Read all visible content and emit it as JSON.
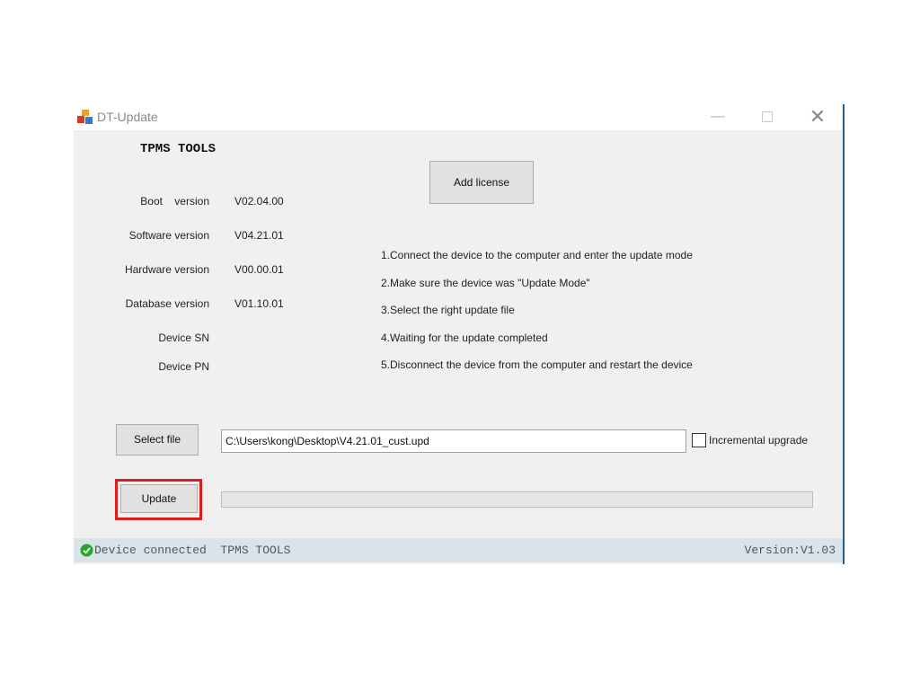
{
  "window": {
    "title": "DT-Update",
    "controls": {
      "minimize": "—",
      "close": "✕"
    }
  },
  "heading": "TPMS TOOLS",
  "info": [
    {
      "label": "Boot    version",
      "value": "V02.04.00"
    },
    {
      "label": "Software version",
      "value": "V04.21.01"
    },
    {
      "label": "Hardware version",
      "value": "V00.00.01"
    },
    {
      "label": "Database version",
      "value": "V01.10.01"
    },
    {
      "label": "Device SN",
      "value": ""
    },
    {
      "label": "Device PN",
      "value": ""
    }
  ],
  "buttons": {
    "add_license": "Add license",
    "select_file": "Select file",
    "update": "Update"
  },
  "instructions": [
    "1.Connect the device to the computer and enter the update mode",
    "2.Make sure the device was \"Update Mode\"",
    "3.Select the right update file",
    "4.Waiting for the update completed",
    "5.Disconnect the device from the computer and restart the device"
  ],
  "file": {
    "path": "C:\\Users\\kong\\Desktop\\V4.21.01_cust.upd",
    "incremental_label": "Incremental upgrade",
    "incremental_checked": false
  },
  "progress": {
    "fraction": 0
  },
  "status": {
    "text": "Device connected  TPMS TOOLS",
    "version": "Version:V1.03",
    "icon": "check-circle-icon"
  },
  "colors": {
    "highlight": "#e01b1b",
    "status_ok": "#2aa52a",
    "statusbar_bg": "#d9e4ea"
  }
}
